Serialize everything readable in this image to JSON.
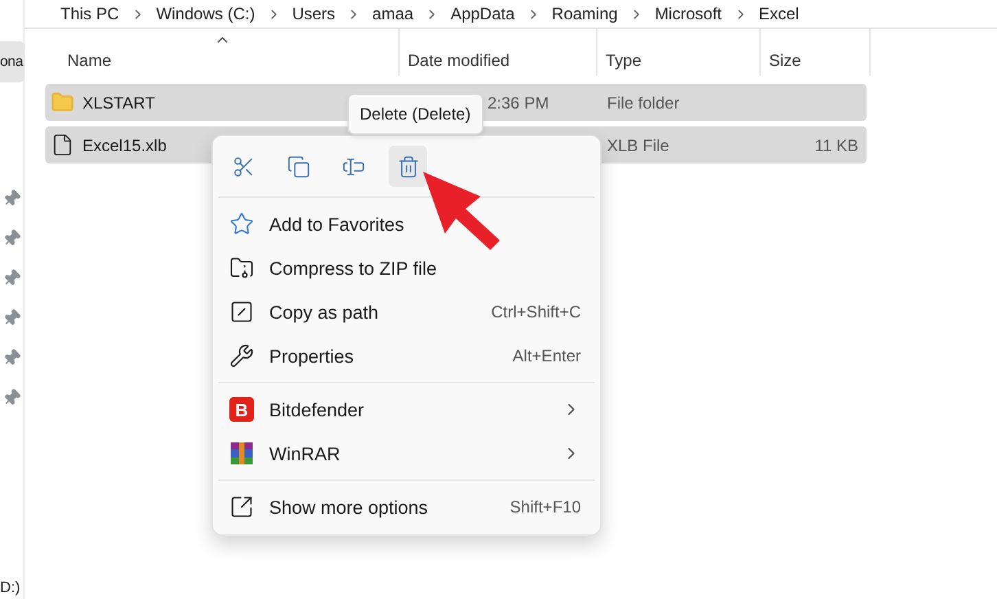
{
  "breadcrumb": [
    "This PC",
    "Windows (C:)",
    "Users",
    "amaa",
    "AppData",
    "Roaming",
    "Microsoft",
    "Excel"
  ],
  "sidebar": {
    "items": [
      {
        "label": "ona",
        "selected": true
      }
    ],
    "drive_label": "D:)"
  },
  "table": {
    "columns": [
      {
        "label": "Name",
        "sorted": true
      },
      {
        "label": "Date modified",
        "sorted": false
      },
      {
        "label": "Type",
        "sorted": false
      },
      {
        "label": "Size",
        "sorted": false
      }
    ],
    "rows": [
      {
        "kind": "folder",
        "name": "XLSTART",
        "date_modified": "2:36 PM",
        "type": "File folder",
        "selected": true
      },
      {
        "kind": "file",
        "name": "Excel15.xlb",
        "type": "XLB File",
        "size": "11 KB",
        "selected": true
      }
    ]
  },
  "context_menu": {
    "quick_actions": [
      {
        "kind": "cut",
        "hovered": false
      },
      {
        "kind": "copy",
        "hovered": false
      },
      {
        "kind": "rename",
        "hovered": false
      },
      {
        "kind": "delete",
        "hovered": true
      }
    ],
    "tooltip": "Delete (Delete)",
    "sections": [
      [
        {
          "kind": "favorite",
          "label": "Add to Favorites",
          "submenu": false
        },
        {
          "kind": "compress",
          "label": "Compress to ZIP file",
          "submenu": false
        },
        {
          "kind": "copy_path",
          "label": "Copy as path",
          "shortcut": "Ctrl+Shift+C",
          "submenu": false
        },
        {
          "kind": "properties",
          "label": "Properties",
          "shortcut": "Alt+Enter",
          "submenu": false
        }
      ],
      [
        {
          "kind": "bitdefender",
          "label": "Bitdefender",
          "icon_text": "B",
          "submenu": true
        },
        {
          "kind": "winrar",
          "label": "WinRAR",
          "submenu": true
        }
      ],
      [
        {
          "kind": "more",
          "label": "Show more options",
          "shortcut": "Shift+F10",
          "submenu": false
        }
      ]
    ]
  }
}
